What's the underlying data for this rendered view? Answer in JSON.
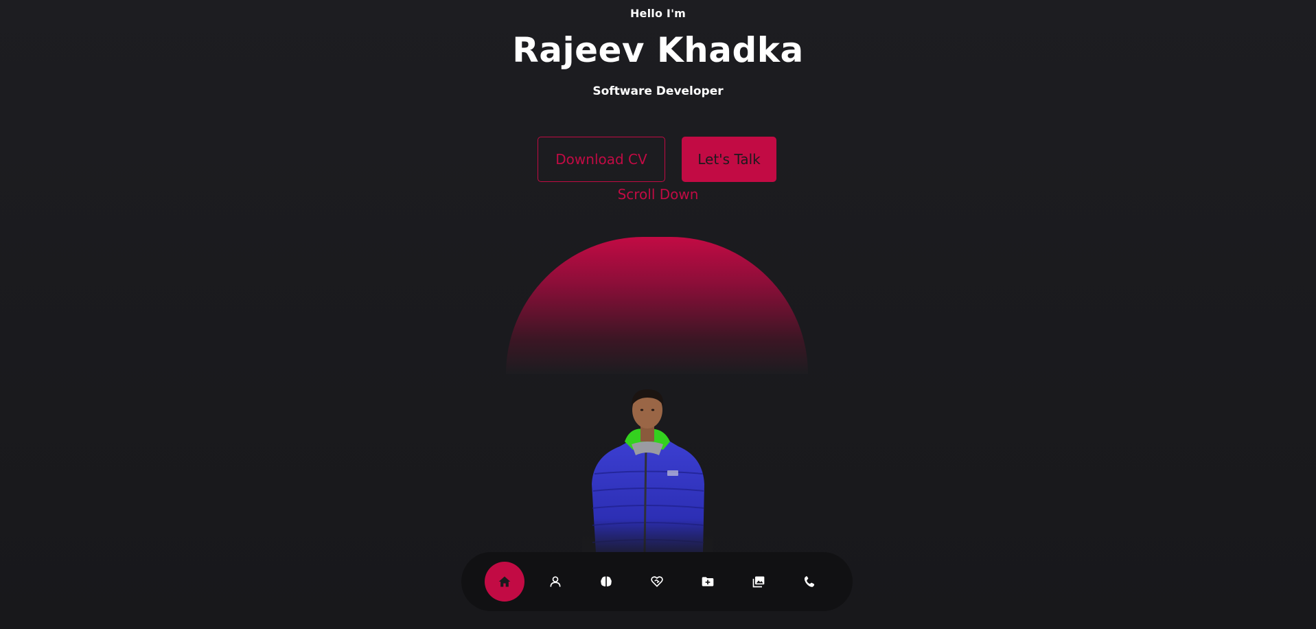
{
  "hero": {
    "greeting": "Hello I'm",
    "name": "Rajeev Khadka",
    "role": "Software Developer"
  },
  "actions": {
    "download_cv": "Download CV",
    "lets_talk": "Let's Talk",
    "scroll_down": "Scroll Down"
  },
  "colors": {
    "accent": "#c20b44",
    "background": "#1c1c20",
    "nav_background": "#111113"
  },
  "nav": {
    "items": [
      {
        "icon": "home-icon",
        "active": true
      },
      {
        "icon": "user-icon",
        "active": false
      },
      {
        "icon": "brain-icon",
        "active": false
      },
      {
        "icon": "handshake-icon",
        "active": false
      },
      {
        "icon": "folder-plus-icon",
        "active": false
      },
      {
        "icon": "images-icon",
        "active": false
      },
      {
        "icon": "phone-icon",
        "active": false
      }
    ]
  }
}
